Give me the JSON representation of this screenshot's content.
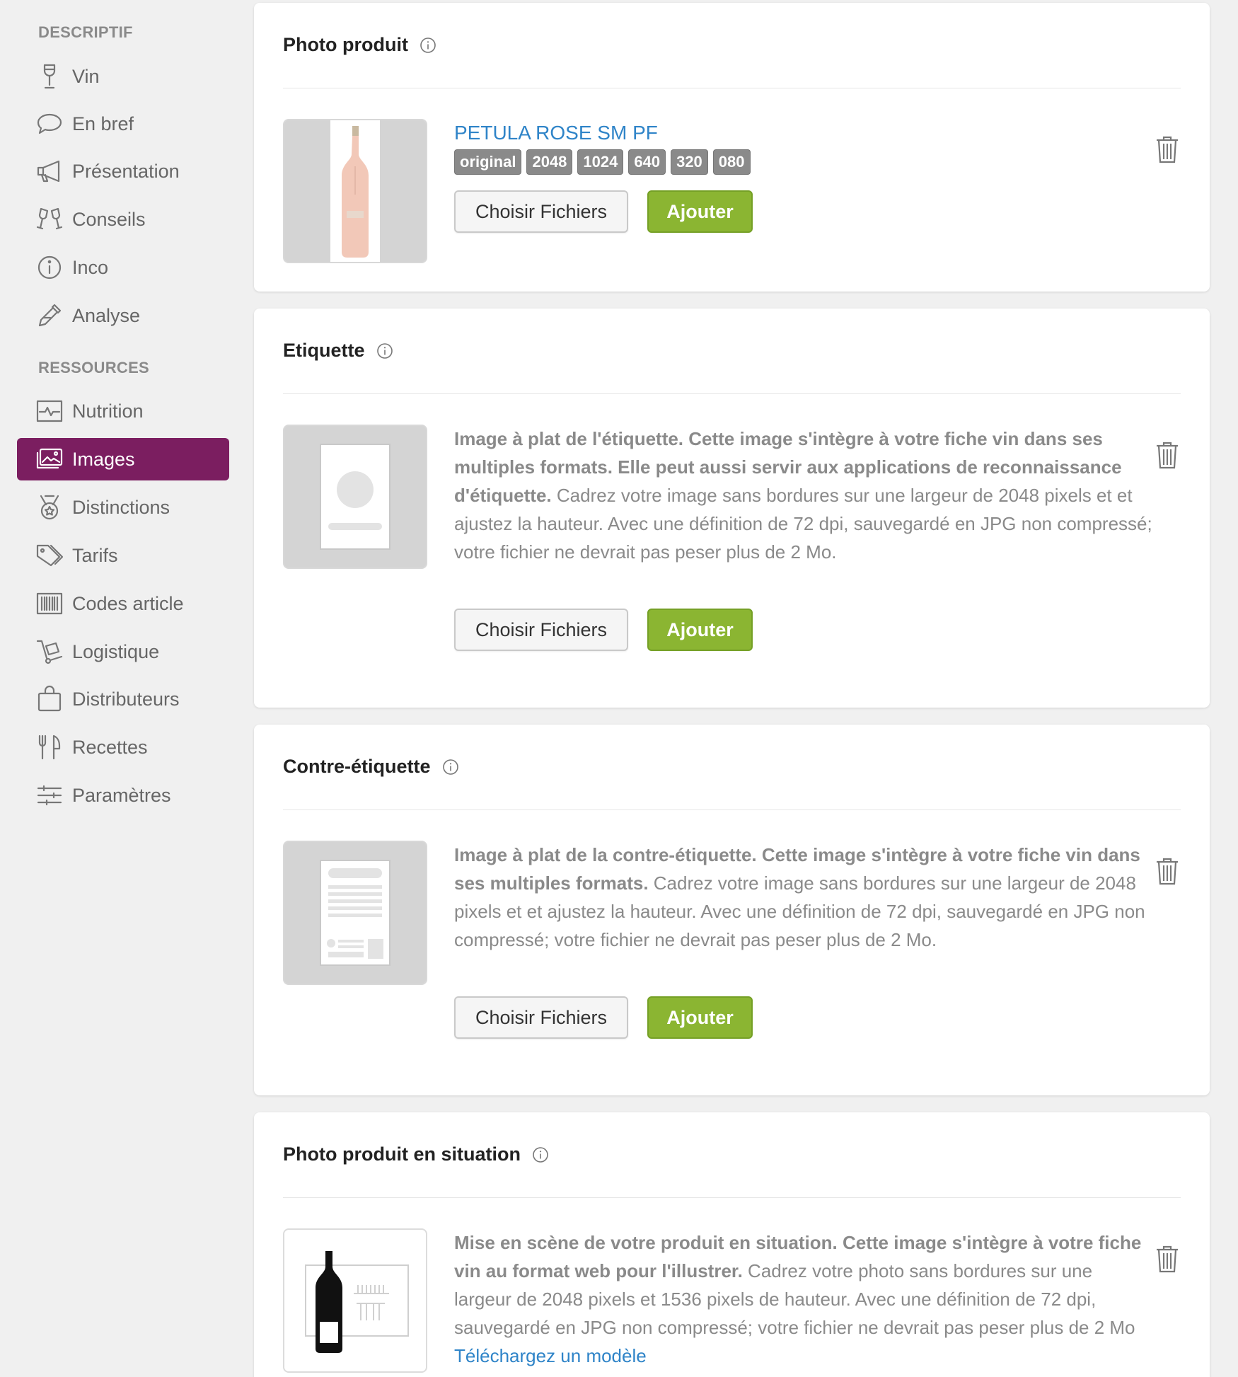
{
  "sidebar": {
    "section_descriptif": "DESCRIPTIF",
    "section_ressources": "RESSOURCES",
    "items": [
      {
        "label": "Vin",
        "icon": "wine-glass-icon"
      },
      {
        "label": "En bref",
        "icon": "speech-bubble-icon"
      },
      {
        "label": "Présentation",
        "icon": "megaphone-icon"
      },
      {
        "label": "Conseils",
        "icon": "toast-glasses-icon"
      },
      {
        "label": "Inco",
        "icon": "info-circle-icon"
      },
      {
        "label": "Analyse",
        "icon": "pipette-icon"
      },
      {
        "label": "Nutrition",
        "icon": "heartbeat-icon"
      },
      {
        "label": "Images",
        "icon": "images-icon",
        "active": true
      },
      {
        "label": "Distinctions",
        "icon": "medal-icon"
      },
      {
        "label": "Tarifs",
        "icon": "tags-icon"
      },
      {
        "label": "Codes article",
        "icon": "barcode-icon"
      },
      {
        "label": "Logistique",
        "icon": "hand-truck-icon"
      },
      {
        "label": "Distributeurs",
        "icon": "shopping-bag-icon"
      },
      {
        "label": "Recettes",
        "icon": "fork-knife-icon"
      },
      {
        "label": "Paramètres",
        "icon": "sliders-icon"
      }
    ]
  },
  "cards": {
    "photo": {
      "title": "Photo produit",
      "product_name": "PETULA ROSE SM PF",
      "badges": [
        "original",
        "2048",
        "1024",
        "640",
        "320",
        "080"
      ],
      "choose_label": "Choisir Fichiers",
      "add_label": "Ajouter"
    },
    "etiquette": {
      "title": "Etiquette",
      "desc_bold": "Image à plat de l'étiquette. Cette image s'intègre à votre fiche vin dans ses multiples formats. Elle peut aussi servir aux applications de reconnaissance d'étiquette.",
      "desc_rest": " Cadrez votre image sans bordures sur une largeur de 2048 pixels et et ajustez la hauteur. Avec une définition de 72 dpi, sauvegardé en JPG non compressé; votre fichier ne devrait pas peser plus de 2 Mo.",
      "choose_label": "Choisir Fichiers",
      "add_label": "Ajouter"
    },
    "contre": {
      "title": "Contre-étiquette",
      "desc_bold": "Image à plat de la contre-étiquette. Cette image s'intègre à votre fiche vin dans ses multiples formats.",
      "desc_rest": " Cadrez votre image sans bordures sur une largeur de 2048 pixels et et ajustez la hauteur. Avec une définition de 72 dpi, sauvegardé en JPG non compressé; votre fichier ne devrait pas peser plus de 2 Mo.",
      "choose_label": "Choisir Fichiers",
      "add_label": "Ajouter"
    },
    "situation": {
      "title": "Photo produit en situation",
      "desc_bold": "Mise en scène de votre produit en situation. Cette image s'intègre à votre fiche vin au format web pour l'illustrer.",
      "desc_rest": " Cadrez votre photo sans bordures sur une largeur de 2048 pixels et 1536 pixels de hauteur. Avec une définition de 72 dpi, sauvegardé en JPG non compressé; votre fichier ne devrait pas peser plus de 2 Mo ",
      "link": "Téléchargez un modèle"
    }
  },
  "colors": {
    "accent": "#7b1e60",
    "add_button": "#8bb532",
    "link": "#2f84c8",
    "badge": "#8a8a8a"
  }
}
